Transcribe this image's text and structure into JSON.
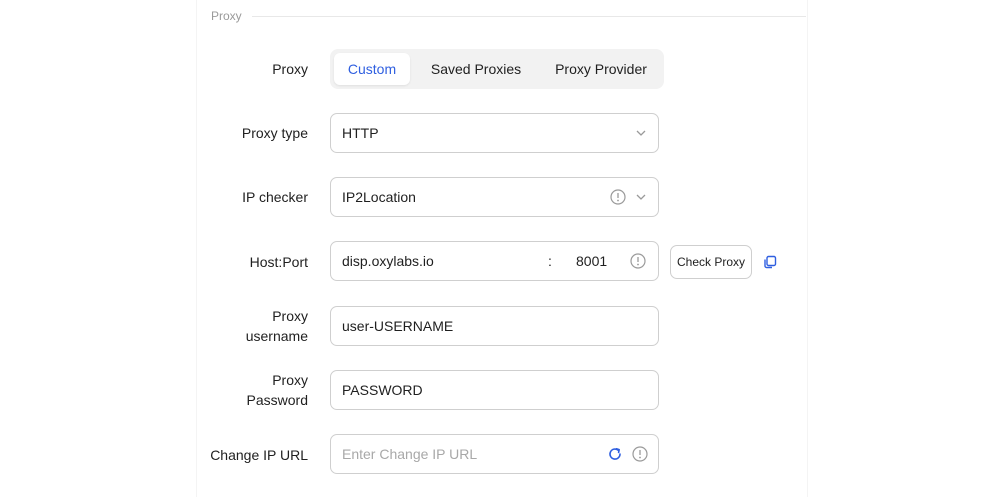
{
  "section": {
    "title": "Proxy"
  },
  "proxy": {
    "label": "Proxy",
    "tabs": [
      {
        "label": "Custom",
        "active": true
      },
      {
        "label": "Saved Proxies",
        "active": false
      },
      {
        "label": "Proxy Provider",
        "active": false
      }
    ]
  },
  "proxy_type": {
    "label": "Proxy type",
    "value": "HTTP"
  },
  "ip_checker": {
    "label": "IP checker",
    "value": "IP2Location"
  },
  "host_port": {
    "label": "Host:Port",
    "host": "disp.oxylabs.io",
    "separator": ":",
    "port": "8001",
    "check_button": "Check Proxy"
  },
  "username": {
    "label_line1": "Proxy",
    "label_line2": "username",
    "value": "user-USERNAME"
  },
  "password": {
    "label_line1": "Proxy",
    "label_line2": "Password",
    "value": "PASSWORD"
  },
  "change_ip": {
    "label": "Change IP URL",
    "placeholder": "Enter Change IP URL"
  },
  "colors": {
    "accent": "#2f5fe0",
    "border": "#cfcfcf",
    "icon_gray": "#9a9a9a"
  },
  "icons": [
    "chevron-down-icon",
    "info-icon",
    "copy-icon",
    "refresh-icon"
  ]
}
